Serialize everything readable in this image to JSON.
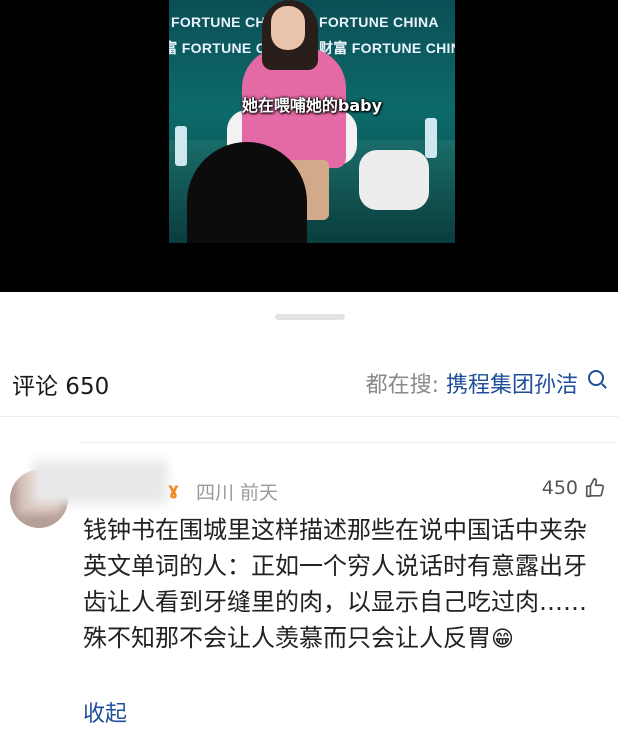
{
  "video": {
    "banner": [
      "FORTUNE CHINA",
      "财富 FORTUNE CHINA"
    ],
    "subtitle": "她在喂哺她的baby"
  },
  "comments": {
    "title": "评论 650",
    "search_prefix": "都在搜:",
    "search_term": "携程集团孙洁",
    "icon": "search-icon"
  },
  "comment": {
    "badge": "ɣ",
    "meta": "四川 前天",
    "likes": "450",
    "text": "钱钟书在围城里这样描述那些在说中国话中夹杂英文单词的人：正如一个穷人说话时有意露出牙齿让人看到牙缝里的肉，以显示自己吃过肉……殊不知那不会让人羡慕而只会让人反胃",
    "emoji": "😁",
    "collapse": "收起"
  },
  "colors": {
    "link": "#1f4f9a",
    "meta": "#9a9a9a"
  }
}
